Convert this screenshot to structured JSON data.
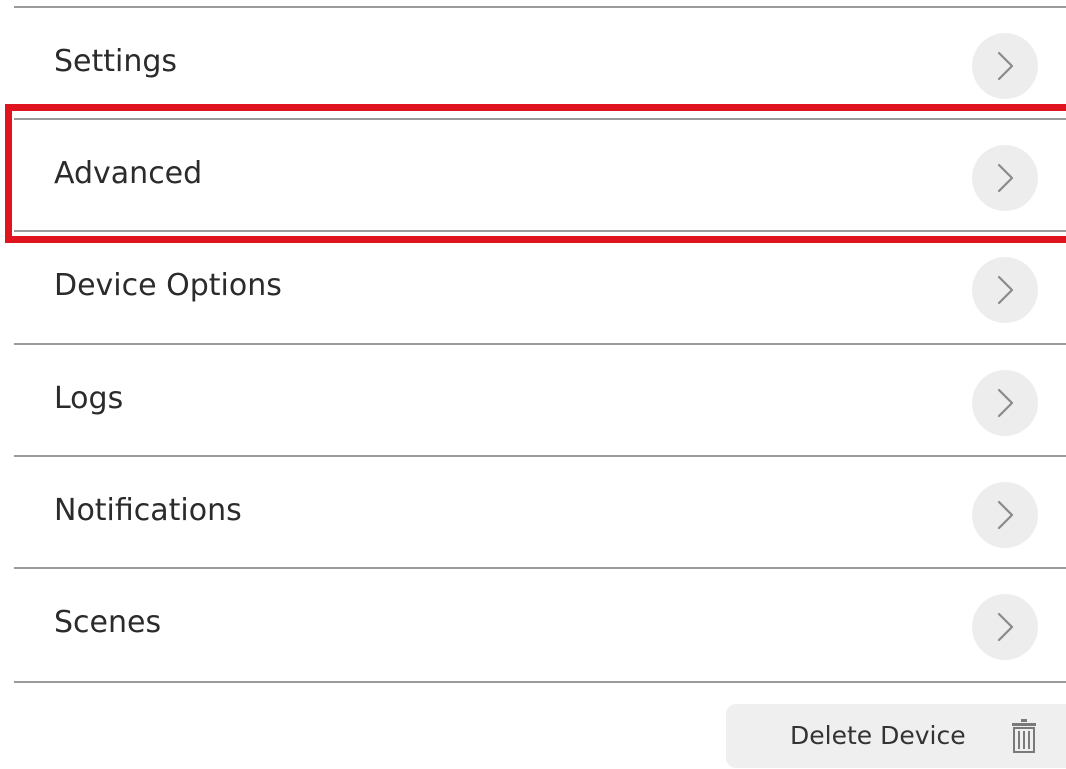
{
  "menu": {
    "items": [
      {
        "label": "Settings"
      },
      {
        "label": "Advanced"
      },
      {
        "label": "Device Options"
      },
      {
        "label": "Logs"
      },
      {
        "label": "Notifications"
      },
      {
        "label": "Scenes"
      }
    ]
  },
  "delete_button": {
    "label": "Delete Device",
    "icon": "trash-icon"
  },
  "colors": {
    "highlight": "#e0141e",
    "divider": "#9a9a9a",
    "chevron_bg": "#ededed",
    "text": "#2b2b2b"
  }
}
